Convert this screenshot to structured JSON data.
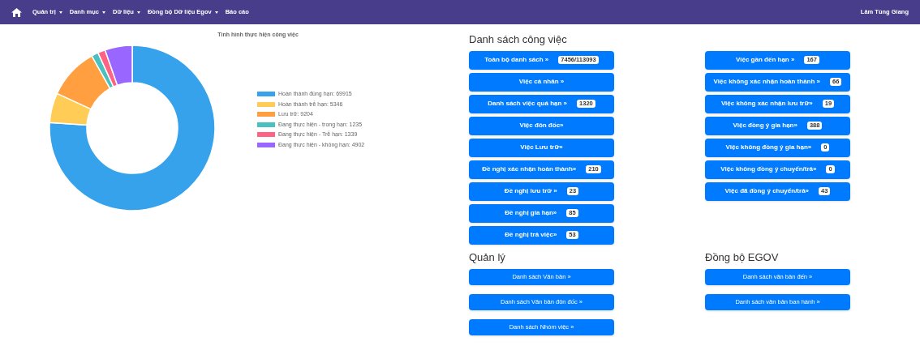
{
  "navbar": {
    "menu": [
      {
        "label": "Quản trị",
        "dropdown": true
      },
      {
        "label": "Danh mục",
        "dropdown": true
      },
      {
        "label": "Dữ liệu",
        "dropdown": true
      },
      {
        "label": "Đồng bộ Dữ liệu Egov",
        "dropdown": true
      },
      {
        "label": "Báo cáo",
        "dropdown": false
      }
    ],
    "user": "Lâm Tùng Giang"
  },
  "chart": {
    "legend": [
      {
        "color": "#36a2eb"
      },
      {
        "color": "#ffcd56"
      },
      {
        "color": "#ff9f40"
      },
      {
        "color": "#4bc0c0"
      },
      {
        "color": "#ff6384"
      },
      {
        "color": "#9966ff"
      }
    ],
    "chart_data": {
      "type": "donut",
      "title": "Tình hình thực hiện công việc",
      "categories": [
        "Hoàn thành đúng hạn: 69915",
        "Hoàn thành trễ hạn: 5346",
        "Lưu trữ: 9204",
        "Đang thực hiện - trong hạn: 1235",
        "Đang thực hiện - Trễ hạn: 1339",
        "Đang thực hiện - không hạn: 4902"
      ],
      "values": [
        69915,
        5346,
        9204,
        1235,
        1339,
        4902
      ]
    }
  },
  "work": {
    "title": "Danh sách công việc",
    "columns": [
      [
        {
          "label": "Toàn bộ danh sách »",
          "badge": "7456/113093"
        },
        {
          "label": "Việc cá nhân »"
        },
        {
          "label": "Danh sách việc quá hạn »",
          "badge": "1320"
        },
        {
          "label": "Việc đôn đốc»"
        },
        {
          "label": "Việc Lưu trữ»"
        },
        {
          "label": "Đề nghị xác nhận hoàn thành»",
          "badge": "210"
        },
        {
          "label": "Đề nghị lưu trữ »",
          "badge": "23"
        },
        {
          "label": "Đề nghị gia hạn»",
          "badge": "85"
        },
        {
          "label": "Đề nghị trả việc»",
          "badge": "53"
        }
      ],
      [
        {
          "label": "Việc gần đến hạn »",
          "badge": "167"
        },
        {
          "label": "Việc không xác nhận hoàn thành »",
          "badge": "66"
        },
        {
          "label": "Việc không xác nhận lưu trữ»",
          "badge": "19"
        },
        {
          "label": "Việc đồng ý gia hạn»",
          "badge": "388"
        },
        {
          "label": "Việc không đồng ý gia hạn»",
          "badge": "0"
        },
        {
          "label": "Việc không đồng ý chuyển/trả»",
          "badge": "0"
        },
        {
          "label": "Việc đã đồng ý chuyển/trả»",
          "badge": "43"
        }
      ]
    ]
  },
  "sections": [
    {
      "title": "Quản lý",
      "buttons": [
        "Danh sách Văn bản »",
        "Danh sách Văn bản đôn đốc »",
        "Danh sách Nhóm việc »"
      ]
    },
    {
      "title": "Đồng bộ EGOV",
      "buttons": [
        "Danh sách văn bản đến »",
        "Danh sách văn bản ban hành »"
      ]
    }
  ]
}
